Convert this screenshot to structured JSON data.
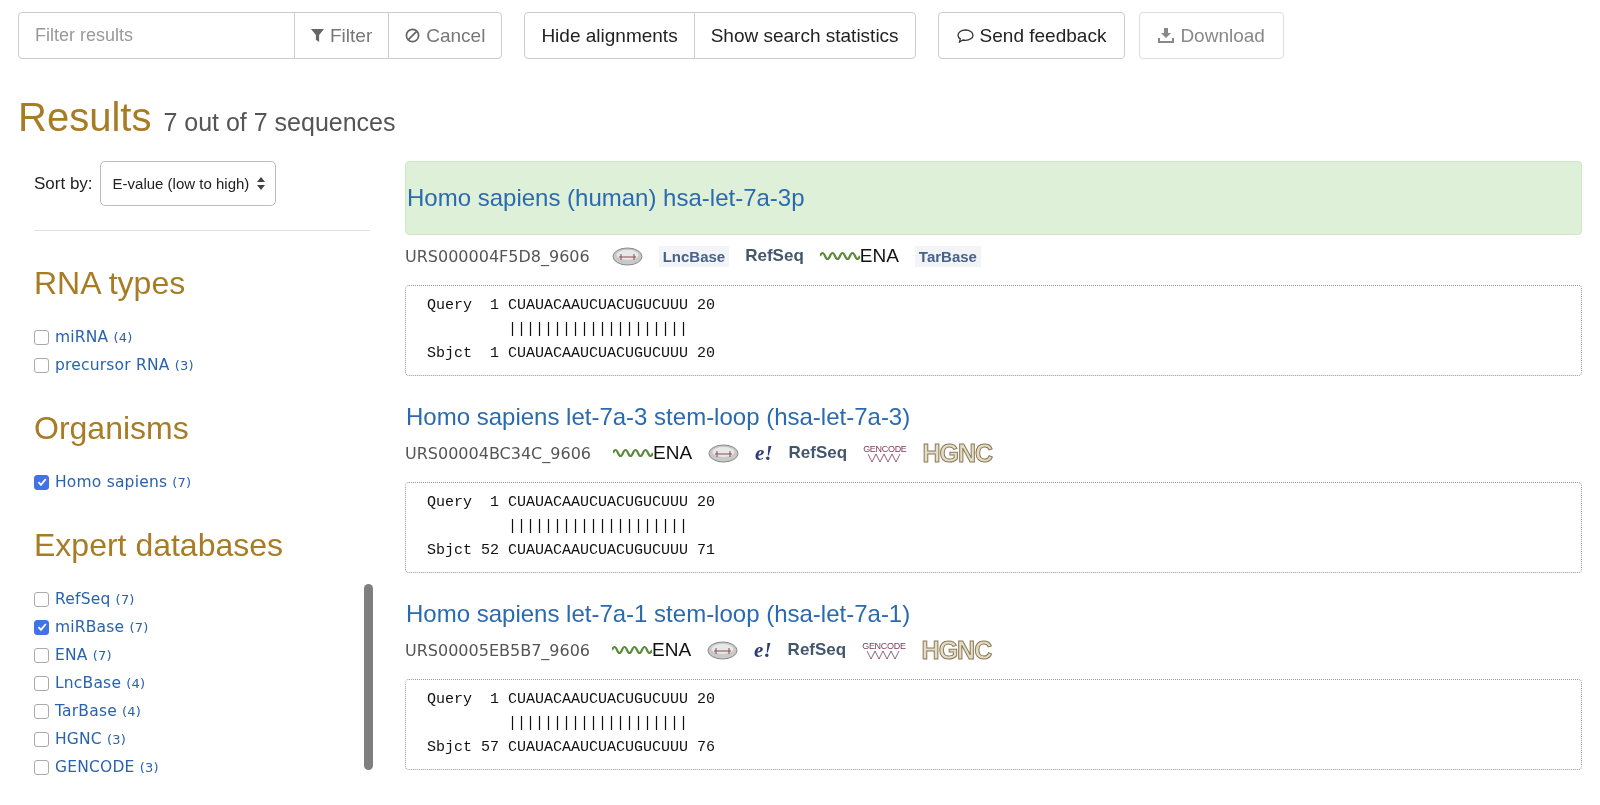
{
  "toolbar": {
    "filter": {
      "placeholder": "Filter results"
    },
    "filter_button": "Filter",
    "cancel_button": "Cancel",
    "view_buttons": [
      "Hide alignments",
      "Show search statistics"
    ],
    "feedback_button": "Send feedback",
    "download_button": {
      "label": "Download",
      "disabled": true
    }
  },
  "heading": {
    "title": "Results",
    "subtitle": "7 out of 7 sequences"
  },
  "sidebar": {
    "sort": {
      "label": "Sort by:",
      "value": "E-value (low to high)"
    },
    "facets": [
      {
        "title": "RNA types",
        "items": [
          {
            "label": "miRNA",
            "count": "(4)",
            "checked": false
          },
          {
            "label": "precursor RNA",
            "count": "(3)",
            "checked": false
          }
        ]
      },
      {
        "title": "Organisms",
        "items": [
          {
            "label": "Homo sapiens",
            "count": "(7)",
            "checked": true
          }
        ]
      },
      {
        "title": "Expert databases",
        "items": [
          {
            "label": "RefSeq",
            "count": "(7)",
            "checked": false
          },
          {
            "label": "miRBase",
            "count": "(7)",
            "checked": true
          },
          {
            "label": "ENA",
            "count": "(7)",
            "checked": false
          },
          {
            "label": "LncBase",
            "count": "(4)",
            "checked": false
          },
          {
            "label": "TarBase",
            "count": "(4)",
            "checked": false
          },
          {
            "label": "HGNC",
            "count": "(3)",
            "checked": false
          },
          {
            "label": "GENCODE",
            "count": "(3)",
            "checked": false
          }
        ]
      }
    ]
  },
  "results": [
    {
      "title": "Homo sapiens (human) hsa-let-7a-3p",
      "highlighted": true,
      "id": "URS000004F5D8_9606",
      "databases": [
        {
          "kind": "mirbase"
        },
        {
          "kind": "lncbase",
          "text": "LncBase"
        },
        {
          "kind": "refseq",
          "text": "RefSeq"
        },
        {
          "kind": "ena",
          "text": "ENA"
        },
        {
          "kind": "tarbase",
          "text": "TarBase"
        }
      ],
      "alignment": [
        "Query  1 CUAUACAAUCUACUGUCUUU 20",
        "         ||||||||||||||||||||",
        "Sbjct  1 CUAUACAAUCUACUGUCUUU 20"
      ]
    },
    {
      "title": "Homo sapiens let-7a-3 stem-loop (hsa-let-7a-3)",
      "highlighted": false,
      "id": "URS00004BC34C_9606",
      "databases": [
        {
          "kind": "ena",
          "text": "ENA"
        },
        {
          "kind": "mirbase"
        },
        {
          "kind": "ensembl",
          "text": "e!"
        },
        {
          "kind": "refseq",
          "text": "RefSeq"
        },
        {
          "kind": "gencode",
          "text": "GENCODE"
        },
        {
          "kind": "hgnc",
          "text": "HGNC"
        }
      ],
      "alignment": [
        "Query  1 CUAUACAAUCUACUGUCUUU 20",
        "         ||||||||||||||||||||",
        "Sbjct 52 CUAUACAAUCUACUGUCUUU 71"
      ]
    },
    {
      "title": "Homo sapiens let-7a-1 stem-loop (hsa-let-7a-1)",
      "highlighted": false,
      "id": "URS00005EB5B7_9606",
      "databases": [
        {
          "kind": "ena",
          "text": "ENA"
        },
        {
          "kind": "mirbase"
        },
        {
          "kind": "ensembl",
          "text": "e!"
        },
        {
          "kind": "refseq",
          "text": "RefSeq"
        },
        {
          "kind": "gencode",
          "text": "GENCODE"
        },
        {
          "kind": "hgnc",
          "text": "HGNC"
        }
      ],
      "alignment": [
        "Query  1 CUAUACAAUCUACUGUCUUU 20",
        "         ||||||||||||||||||||",
        "Sbjct 57 CUAUACAAUCUACUGUCUUU 76"
      ]
    }
  ]
}
